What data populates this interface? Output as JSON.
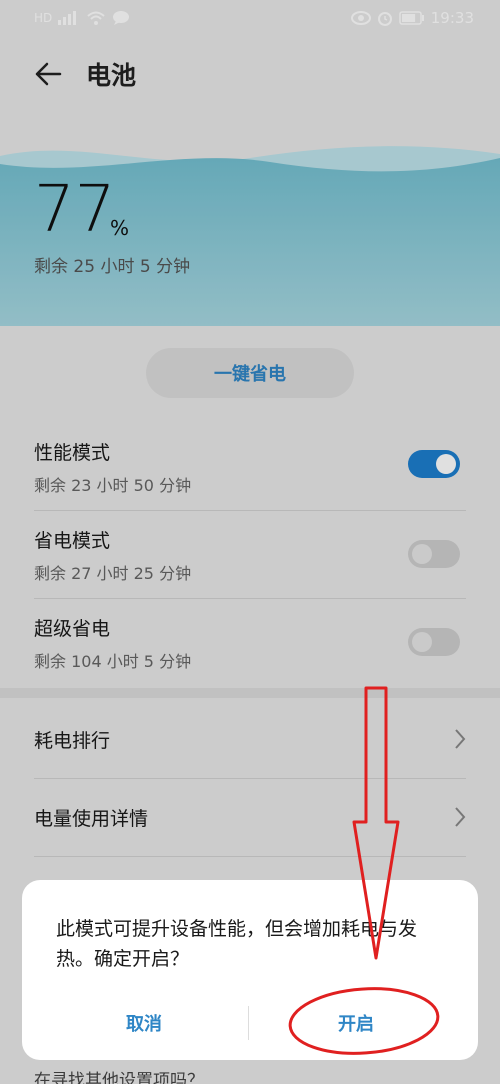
{
  "status_bar": {
    "left_icons": [
      "hd-icon",
      "signal-icon",
      "wifi-icon",
      "message-icon"
    ],
    "right_icons": [
      "eye-icon",
      "alarm-icon",
      "battery-icon"
    ],
    "time": "19:33"
  },
  "header": {
    "title": "电池"
  },
  "battery": {
    "percent": "77",
    "percent_sign": "%",
    "remaining": "剩余 25 小时 5 分钟",
    "level": 77
  },
  "save_button": {
    "label": "一键省电"
  },
  "modes": [
    {
      "title": "性能模式",
      "subtitle": "剩余 23 小时 50 分钟",
      "enabled": true
    },
    {
      "title": "省电模式",
      "subtitle": "剩余 27 小时 25 分钟",
      "enabled": false
    },
    {
      "title": "超级省电",
      "subtitle": "剩余 104 小时 5 分钟",
      "enabled": false
    }
  ],
  "nav": [
    {
      "label": "耗电排行"
    },
    {
      "label": "电量使用详情"
    }
  ],
  "hint": "在寻找其他设置项吗？",
  "dialog": {
    "message": "此模式可提升设备性能，但会增加耗电与发热。确定开启？",
    "cancel_label": "取消",
    "confirm_label": "开启"
  },
  "colors": {
    "accent": "#2f86c6",
    "toggle_on": "#1d7fcf",
    "wave_light": "#9fd3df",
    "wave_dark": "#5fb3c6",
    "annotation_red": "#e02020"
  }
}
